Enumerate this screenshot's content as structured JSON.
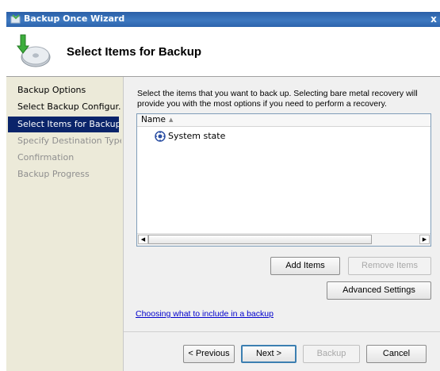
{
  "window": {
    "title": "Backup Once Wizard",
    "close_glyph": "x",
    "app_icon": "backup-icon"
  },
  "header": {
    "title": "Select Items for Backup",
    "icon": "backup-wizard-icon"
  },
  "sidebar": {
    "steps": [
      {
        "label": "Backup Options",
        "state": "done"
      },
      {
        "label": "Select Backup Configur...",
        "state": "done"
      },
      {
        "label": "Select Items for Backup",
        "state": "current"
      },
      {
        "label": "Specify Destination Type",
        "state": "pending"
      },
      {
        "label": "Confirmation",
        "state": "pending"
      },
      {
        "label": "Backup Progress",
        "state": "pending"
      }
    ]
  },
  "main": {
    "intro": "Select the items that you want to back up. Selecting bare metal recovery will provide you with the most options if you need to perform a recovery.",
    "list": {
      "column_header": "Name",
      "items": [
        {
          "label": "System state",
          "icon": "system-state-icon"
        }
      ]
    },
    "add_items_label": "Add Items",
    "remove_items_label": "Remove Items",
    "advanced_settings_label": "Advanced Settings",
    "help_link": "Choosing what to include in a backup"
  },
  "footer": {
    "previous_label": "< Previous",
    "next_label": "Next >",
    "backup_label": "Backup",
    "cancel_label": "Cancel"
  }
}
